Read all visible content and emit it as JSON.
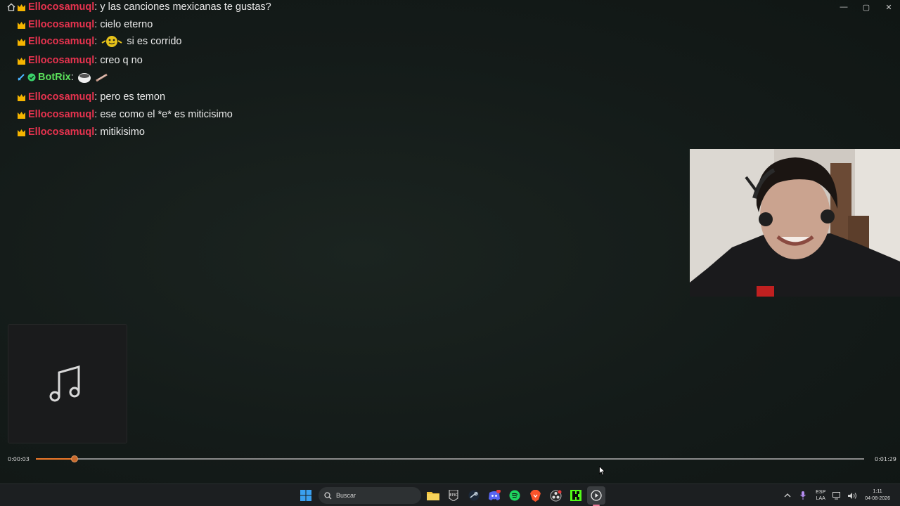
{
  "window": {
    "controls": [
      "—",
      "▢",
      "✕"
    ]
  },
  "chat": {
    "messages": [
      {
        "user": "Ellocosamuql",
        "text": "y las canciones mexicanas te gustas?"
      },
      {
        "user": "Ellocosamuql",
        "text": "cielo eterno"
      },
      {
        "user": "Ellocosamuql",
        "text": "si es corrido"
      },
      {
        "user": "Ellocosamuql",
        "text": "creo q no"
      },
      {
        "user": "BotRix",
        "text": ""
      },
      {
        "user": "Ellocosamuql",
        "text": "pero es temon"
      },
      {
        "user": "Ellocosamuql",
        "text": "ese como el *e* es miticisimo"
      },
      {
        "user": "Ellocosamuql",
        "text": "mitikisimo"
      }
    ],
    "colon": ":"
  },
  "player": {
    "elapsed": "0:00:03",
    "total": "0:01:29",
    "progress_fraction": 0.047
  },
  "taskbar": {
    "search_placeholder": "Buscar",
    "lang_line1": "ESP",
    "lang_line2": "LAA",
    "time": "1:11",
    "date": "04-08-2026"
  },
  "colors": {
    "username": "#e8334f",
    "bot_username": "#5be05b",
    "progress_accent": "#f07a2a"
  }
}
